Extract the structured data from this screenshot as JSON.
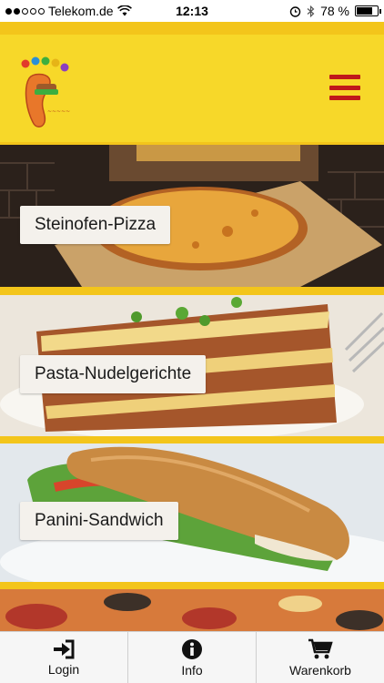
{
  "status": {
    "carrier": "Telekom.de",
    "time": "12:13",
    "battery": "78 %",
    "battery_level": 0.78
  },
  "header": {
    "logo_icon": "footprint-logo",
    "menu_icon": "hamburger-icon",
    "accent_color": "#c0181a",
    "background_color": "#f7d829"
  },
  "categories": [
    {
      "label": "Steinofen-Pizza"
    },
    {
      "label": "Pasta-Nudelgerichte"
    },
    {
      "label": "Panini-Sandwich"
    }
  ],
  "tabbar": {
    "login": {
      "label": "Login",
      "icon": "login-icon"
    },
    "info": {
      "label": "Info",
      "icon": "info-icon"
    },
    "cart": {
      "label": "Warenkorb",
      "icon": "cart-icon"
    }
  }
}
